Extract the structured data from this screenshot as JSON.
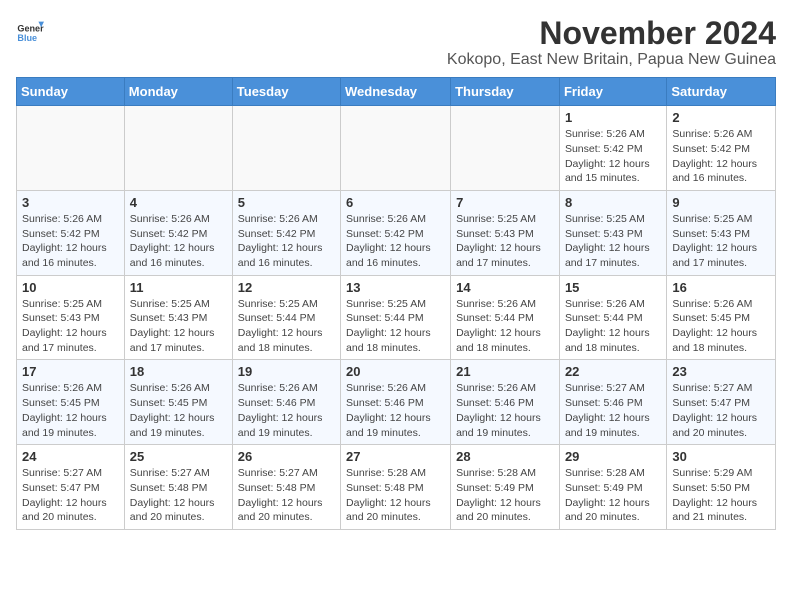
{
  "logo": {
    "general": "General",
    "blue": "Blue"
  },
  "title": "November 2024",
  "subtitle": "Kokopo, East New Britain, Papua New Guinea",
  "days_of_week": [
    "Sunday",
    "Monday",
    "Tuesday",
    "Wednesday",
    "Thursday",
    "Friday",
    "Saturday"
  ],
  "weeks": [
    [
      {
        "day": "",
        "info": ""
      },
      {
        "day": "",
        "info": ""
      },
      {
        "day": "",
        "info": ""
      },
      {
        "day": "",
        "info": ""
      },
      {
        "day": "",
        "info": ""
      },
      {
        "day": "1",
        "info": "Sunrise: 5:26 AM\nSunset: 5:42 PM\nDaylight: 12 hours and 15 minutes."
      },
      {
        "day": "2",
        "info": "Sunrise: 5:26 AM\nSunset: 5:42 PM\nDaylight: 12 hours and 16 minutes."
      }
    ],
    [
      {
        "day": "3",
        "info": "Sunrise: 5:26 AM\nSunset: 5:42 PM\nDaylight: 12 hours and 16 minutes."
      },
      {
        "day": "4",
        "info": "Sunrise: 5:26 AM\nSunset: 5:42 PM\nDaylight: 12 hours and 16 minutes."
      },
      {
        "day": "5",
        "info": "Sunrise: 5:26 AM\nSunset: 5:42 PM\nDaylight: 12 hours and 16 minutes."
      },
      {
        "day": "6",
        "info": "Sunrise: 5:26 AM\nSunset: 5:42 PM\nDaylight: 12 hours and 16 minutes."
      },
      {
        "day": "7",
        "info": "Sunrise: 5:25 AM\nSunset: 5:43 PM\nDaylight: 12 hours and 17 minutes."
      },
      {
        "day": "8",
        "info": "Sunrise: 5:25 AM\nSunset: 5:43 PM\nDaylight: 12 hours and 17 minutes."
      },
      {
        "day": "9",
        "info": "Sunrise: 5:25 AM\nSunset: 5:43 PM\nDaylight: 12 hours and 17 minutes."
      }
    ],
    [
      {
        "day": "10",
        "info": "Sunrise: 5:25 AM\nSunset: 5:43 PM\nDaylight: 12 hours and 17 minutes."
      },
      {
        "day": "11",
        "info": "Sunrise: 5:25 AM\nSunset: 5:43 PM\nDaylight: 12 hours and 17 minutes."
      },
      {
        "day": "12",
        "info": "Sunrise: 5:25 AM\nSunset: 5:44 PM\nDaylight: 12 hours and 18 minutes."
      },
      {
        "day": "13",
        "info": "Sunrise: 5:25 AM\nSunset: 5:44 PM\nDaylight: 12 hours and 18 minutes."
      },
      {
        "day": "14",
        "info": "Sunrise: 5:26 AM\nSunset: 5:44 PM\nDaylight: 12 hours and 18 minutes."
      },
      {
        "day": "15",
        "info": "Sunrise: 5:26 AM\nSunset: 5:44 PM\nDaylight: 12 hours and 18 minutes."
      },
      {
        "day": "16",
        "info": "Sunrise: 5:26 AM\nSunset: 5:45 PM\nDaylight: 12 hours and 18 minutes."
      }
    ],
    [
      {
        "day": "17",
        "info": "Sunrise: 5:26 AM\nSunset: 5:45 PM\nDaylight: 12 hours and 19 minutes."
      },
      {
        "day": "18",
        "info": "Sunrise: 5:26 AM\nSunset: 5:45 PM\nDaylight: 12 hours and 19 minutes."
      },
      {
        "day": "19",
        "info": "Sunrise: 5:26 AM\nSunset: 5:46 PM\nDaylight: 12 hours and 19 minutes."
      },
      {
        "day": "20",
        "info": "Sunrise: 5:26 AM\nSunset: 5:46 PM\nDaylight: 12 hours and 19 minutes."
      },
      {
        "day": "21",
        "info": "Sunrise: 5:26 AM\nSunset: 5:46 PM\nDaylight: 12 hours and 19 minutes."
      },
      {
        "day": "22",
        "info": "Sunrise: 5:27 AM\nSunset: 5:46 PM\nDaylight: 12 hours and 19 minutes."
      },
      {
        "day": "23",
        "info": "Sunrise: 5:27 AM\nSunset: 5:47 PM\nDaylight: 12 hours and 20 minutes."
      }
    ],
    [
      {
        "day": "24",
        "info": "Sunrise: 5:27 AM\nSunset: 5:47 PM\nDaylight: 12 hours and 20 minutes."
      },
      {
        "day": "25",
        "info": "Sunrise: 5:27 AM\nSunset: 5:48 PM\nDaylight: 12 hours and 20 minutes."
      },
      {
        "day": "26",
        "info": "Sunrise: 5:27 AM\nSunset: 5:48 PM\nDaylight: 12 hours and 20 minutes."
      },
      {
        "day": "27",
        "info": "Sunrise: 5:28 AM\nSunset: 5:48 PM\nDaylight: 12 hours and 20 minutes."
      },
      {
        "day": "28",
        "info": "Sunrise: 5:28 AM\nSunset: 5:49 PM\nDaylight: 12 hours and 20 minutes."
      },
      {
        "day": "29",
        "info": "Sunrise: 5:28 AM\nSunset: 5:49 PM\nDaylight: 12 hours and 20 minutes."
      },
      {
        "day": "30",
        "info": "Sunrise: 5:29 AM\nSunset: 5:50 PM\nDaylight: 12 hours and 21 minutes."
      }
    ]
  ]
}
